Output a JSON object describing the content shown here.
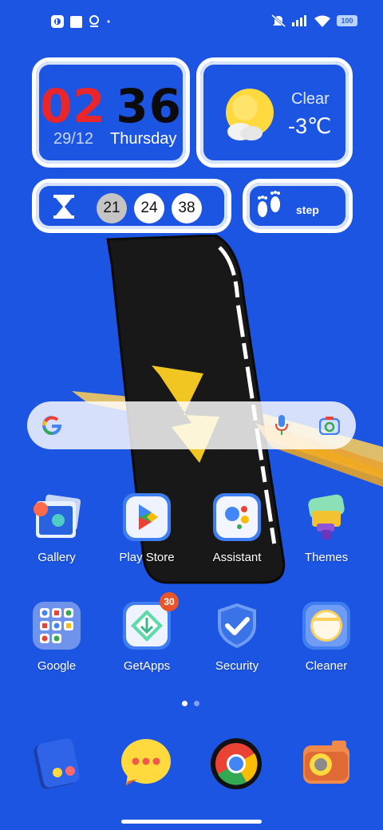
{
  "status_bar": {
    "left_icons": [
      "app-notification-icon",
      "square-notification-icon",
      "location-pin-icon",
      "dot-icon"
    ],
    "right_icons": [
      "mute-icon",
      "signal-icon",
      "wifi-icon"
    ],
    "battery": "100"
  },
  "widgets": {
    "clock": {
      "hour": "02",
      "minute": "36",
      "date": "29/12",
      "day": "Thursday",
      "hour_color": "#e8262c"
    },
    "weather": {
      "condition": "Clear",
      "temperature": "-3℃",
      "icon": "sun-cloud-icon"
    },
    "timer": {
      "icon": "hourglass-icon",
      "numbers": [
        "21",
        "24",
        "38"
      ]
    },
    "steps": {
      "icon": "footprints-icon",
      "label": "step"
    }
  },
  "search": {
    "logo": "google-g-icon",
    "mic_icon": "mic-icon",
    "lens_icon": "lens-icon"
  },
  "apps": [
    {
      "label": "Gallery",
      "icon": "gallery-icon"
    },
    {
      "label": "Play Store",
      "icon": "play-store-icon"
    },
    {
      "label": "Assistant",
      "icon": "assistant-icon"
    },
    {
      "label": "Themes",
      "icon": "themes-icon"
    },
    {
      "label": "Google",
      "icon": "google-folder-icon"
    },
    {
      "label": "GetApps",
      "icon": "getapps-icon",
      "badge": "30"
    },
    {
      "label": "Security",
      "icon": "security-icon"
    },
    {
      "label": "Cleaner",
      "icon": "cleaner-icon"
    }
  ],
  "page_indicator": {
    "total": 2,
    "active": 1
  },
  "dock": [
    {
      "icon": "phone-icon"
    },
    {
      "icon": "messages-icon"
    },
    {
      "icon": "chrome-icon"
    },
    {
      "icon": "camera-icon"
    }
  ],
  "colors": {
    "background": "#1d55e3",
    "accent_red": "#e8262c",
    "badge": "#e8552a"
  }
}
